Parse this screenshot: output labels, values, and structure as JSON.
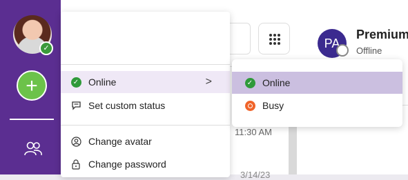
{
  "sidebar": {
    "avatar_alt": "User avatar",
    "add_label": "+"
  },
  "background": {
    "time": "11:30 AM",
    "date": "3/14/23"
  },
  "contact": {
    "initials": "PA",
    "name": "Premium",
    "status": "Offline"
  },
  "menu": {
    "items": [
      {
        "label": "Online",
        "icon": "green-check-icon"
      },
      {
        "label": "Set custom status",
        "icon": "chat-bubble-icon"
      },
      {
        "label": "Change avatar",
        "icon": "user-circle-icon"
      },
      {
        "label": "Change password",
        "icon": "lock-icon"
      }
    ],
    "chevron": ">"
  },
  "submenu": {
    "items": [
      {
        "label": "Online",
        "icon": "green-check-icon"
      },
      {
        "label": "Busy",
        "icon": "busy-icon"
      }
    ]
  },
  "colors": {
    "rail": "#5b2e91",
    "add_button": "#6cc24a",
    "online": "#2f9a3a",
    "busy": "#f0642a",
    "submenu_active": "#cbbfe0",
    "menu_active": "#efe8f6"
  }
}
